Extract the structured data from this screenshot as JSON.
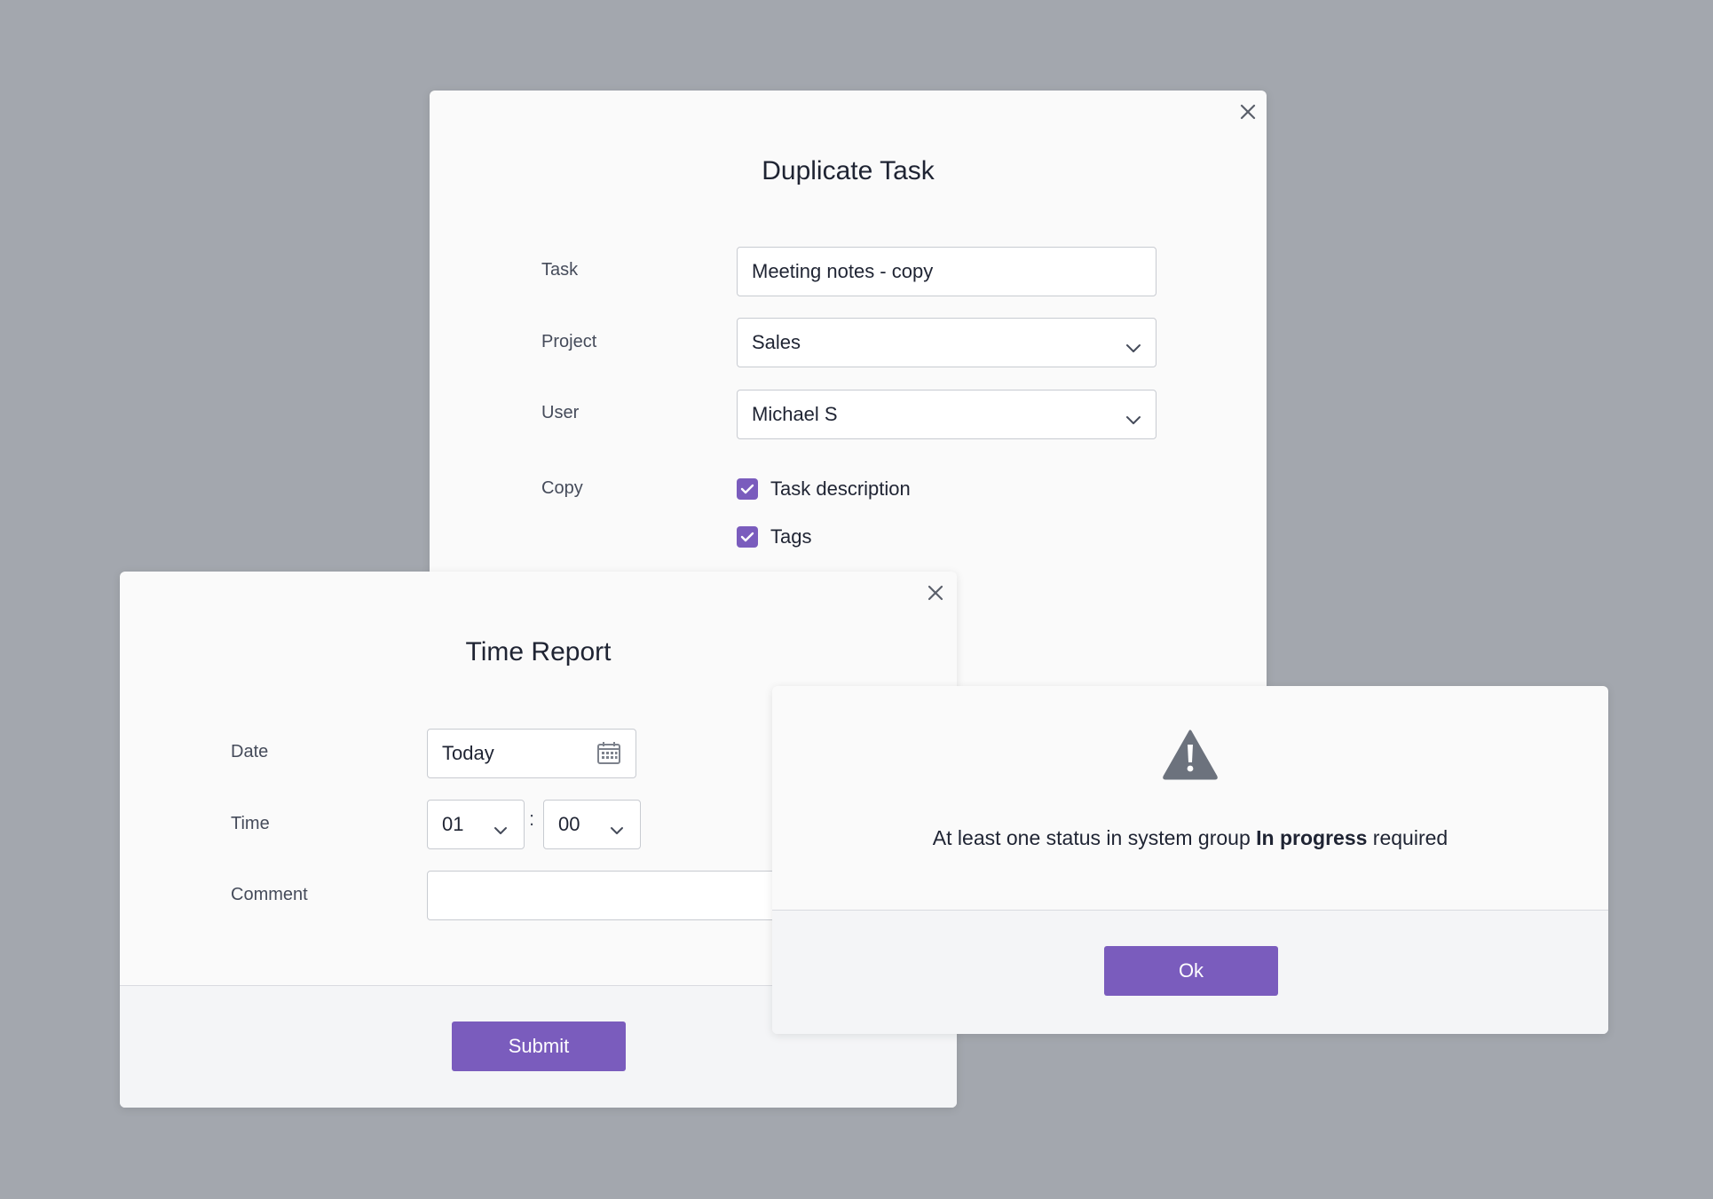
{
  "duplicate_task": {
    "title": "Duplicate Task",
    "task_label": "Task",
    "task_value": "Meeting notes - copy",
    "project_label": "Project",
    "project_value": "Sales",
    "user_label": "User",
    "user_value": "Michael S",
    "copy_label": "Copy",
    "copy_options": [
      {
        "label": "Task description",
        "checked": true
      },
      {
        "label": "Tags",
        "checked": true
      }
    ]
  },
  "time_report": {
    "title": "Time Report",
    "date_label": "Date",
    "date_value": "Today",
    "time_label": "Time",
    "hours_value": "01",
    "separator": ":",
    "minutes_value": "00",
    "comment_label": "Comment",
    "comment_value": "",
    "submit_label": "Submit"
  },
  "alert": {
    "icon": "warning-icon",
    "message_prefix": "At least one status in system group ",
    "message_bold": "In progress",
    "message_suffix": " required",
    "ok_label": "Ok"
  },
  "colors": {
    "accent": "#7a5cbd",
    "backdrop": "#a3a7ae",
    "dialog_bg": "#fafafa",
    "footer_bg": "#f4f5f7"
  }
}
